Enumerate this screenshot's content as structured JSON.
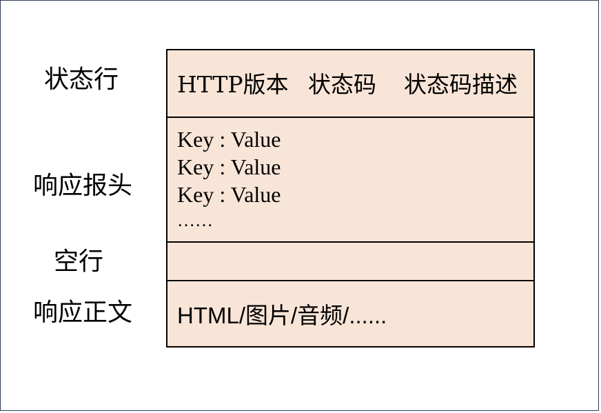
{
  "labels": {
    "status_line": "状态行",
    "response_headers": "响应报头",
    "blank_line": "空行",
    "response_body": "响应正文"
  },
  "status_row": {
    "http_version": "HTTP版本",
    "status_code": "状态码",
    "status_description": "状态码描述"
  },
  "headers_row": {
    "lines": [
      "Key : Value",
      "Key : Value",
      "Key : Value",
      "……"
    ]
  },
  "body_row": {
    "content": "HTML/图片/音频/......"
  },
  "colors": {
    "box_fill": "#f8e5d8",
    "box_border": "#000000",
    "frame_border": "#2f3d55"
  }
}
